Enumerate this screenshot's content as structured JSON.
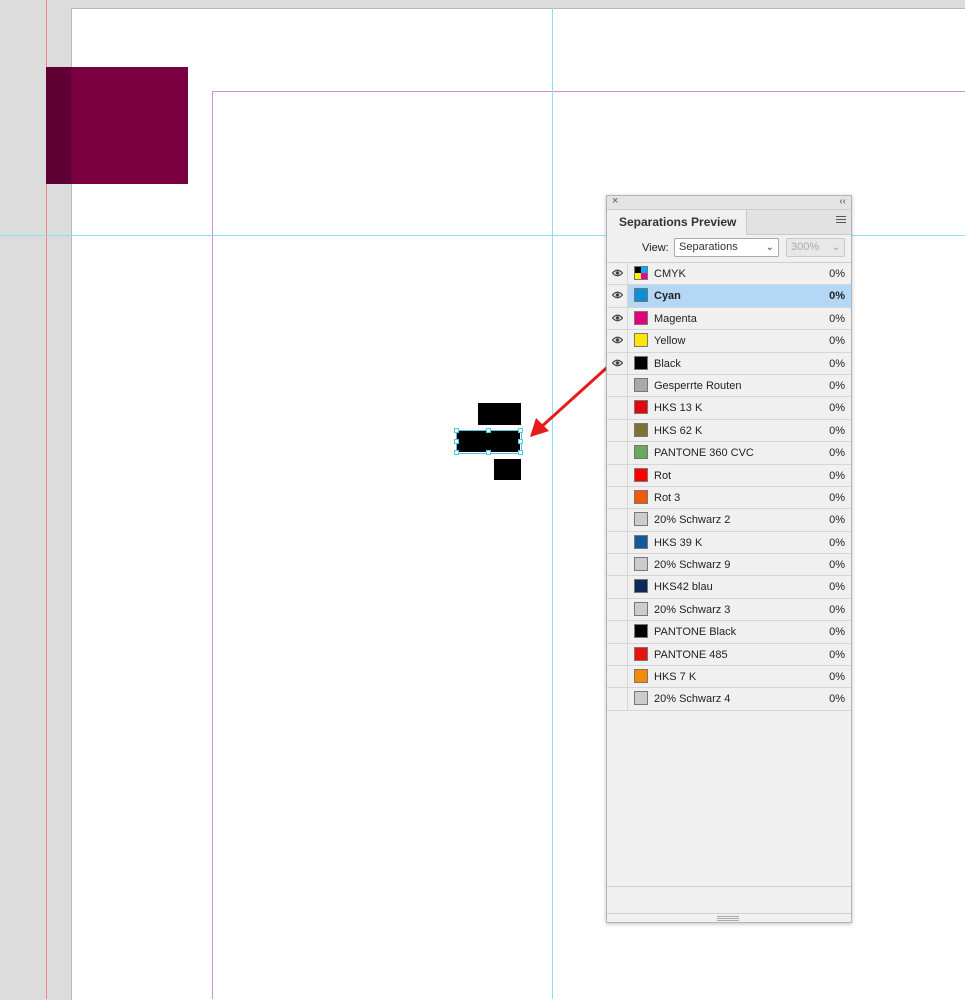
{
  "panel": {
    "title": "Separations Preview",
    "close_glyph": "×",
    "collapse_glyph": "‹‹",
    "view": {
      "label": "View:",
      "selected": "Separations",
      "zoom": "300%"
    },
    "inks": [
      {
        "name": "CMYK",
        "pct": "0%",
        "color": "cmyk",
        "eye": true,
        "selected": false
      },
      {
        "name": "Cyan",
        "pct": "0%",
        "color": "#0b8fd9",
        "eye": true,
        "selected": true
      },
      {
        "name": "Magenta",
        "pct": "0%",
        "color": "#e2007a",
        "eye": true,
        "selected": false
      },
      {
        "name": "Yellow",
        "pct": "0%",
        "color": "#ffe600",
        "eye": true,
        "selected": false
      },
      {
        "name": "Black",
        "pct": "0%",
        "color": "#000000",
        "eye": true,
        "selected": false
      },
      {
        "name": "Gesperrte Routen",
        "pct": "0%",
        "color": "#a9a9a9",
        "eye": false,
        "selected": false
      },
      {
        "name": "HKS 13 K",
        "pct": "0%",
        "color": "#e30613",
        "eye": false,
        "selected": false
      },
      {
        "name": "HKS 62 K",
        "pct": "0%",
        "color": "#7a7434",
        "eye": false,
        "selected": false
      },
      {
        "name": "PANTONE 360 CVC",
        "pct": "0%",
        "color": "#6aa85f",
        "eye": false,
        "selected": false
      },
      {
        "name": "Rot",
        "pct": "0%",
        "color": "#ff0000",
        "eye": false,
        "selected": false
      },
      {
        "name": "Rot 3",
        "pct": "0%",
        "color": "#f05a0a",
        "eye": false,
        "selected": false
      },
      {
        "name": "20% Schwarz 2",
        "pct": "0%",
        "color": "#cccccc",
        "eye": false,
        "selected": false
      },
      {
        "name": "HKS 39 K",
        "pct": "0%",
        "color": "#145a9a",
        "eye": false,
        "selected": false
      },
      {
        "name": "20% Schwarz 9",
        "pct": "0%",
        "color": "#cccccc",
        "eye": false,
        "selected": false
      },
      {
        "name": "HKS42 blau",
        "pct": "0%",
        "color": "#0d2a57",
        "eye": false,
        "selected": false
      },
      {
        "name": "20% Schwarz 3",
        "pct": "0%",
        "color": "#cccccc",
        "eye": false,
        "selected": false
      },
      {
        "name": "PANTONE Black",
        "pct": "0%",
        "color": "#000000",
        "eye": false,
        "selected": false
      },
      {
        "name": "PANTONE 485",
        "pct": "0%",
        "color": "#e8130f",
        "eye": false,
        "selected": false
      },
      {
        "name": "HKS 7 K",
        "pct": "0%",
        "color": "#f58a07",
        "eye": false,
        "selected": false
      },
      {
        "name": "20% Schwarz 4",
        "pct": "0%",
        "color": "#cccccc",
        "eye": false,
        "selected": false
      }
    ]
  },
  "colors": {
    "annotation_arrow": "#e81a1a",
    "magenta_block": "#7a0042",
    "selection": "#4fc8e6"
  }
}
